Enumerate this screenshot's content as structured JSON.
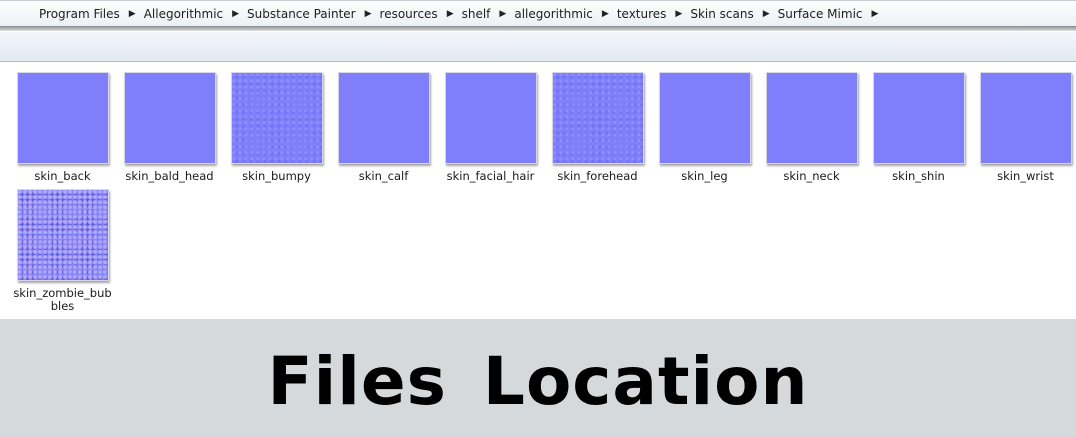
{
  "breadcrumb": [
    "Program Files",
    "Allegorithmic",
    "Substance Painter",
    "resources",
    "shelf",
    "allegorithmic",
    "textures",
    "Skin scans",
    "Surface Mimic"
  ],
  "files": [
    {
      "name": "skin_back"
    },
    {
      "name": "skin_bald_head"
    },
    {
      "name": "skin_bumpy"
    },
    {
      "name": "skin_calf"
    },
    {
      "name": "skin_facial_hair"
    },
    {
      "name": "skin_forehead"
    },
    {
      "name": "skin_leg"
    },
    {
      "name": "skin_neck"
    },
    {
      "name": "skin_shin"
    },
    {
      "name": "skin_wrist"
    },
    {
      "name": "skin_zombie_bubbles",
      "label_line1": "skin_zombie_bub",
      "label_line2": "bles"
    }
  ],
  "caption": "Files Location",
  "colors": {
    "thumbnail": "#7f7ffb",
    "caption_band": "#d5d9dc"
  }
}
